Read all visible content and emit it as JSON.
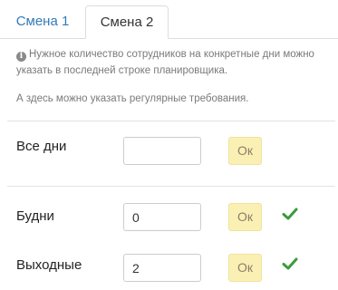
{
  "tabs": [
    {
      "label": "Смена 1",
      "active": false
    },
    {
      "label": "Смена 2",
      "active": true
    }
  ],
  "hints": {
    "info": "Нужное количество сотрудников на конкретные дни можно указать в последней строке планировщика.",
    "regular": "А здесь можно указать регулярные требования."
  },
  "rows": [
    {
      "label": "Все дни",
      "value": "",
      "ok_label": "Ок",
      "confirmed": false
    },
    {
      "label": "Будни",
      "value": "0",
      "ok_label": "Ок",
      "confirmed": true
    },
    {
      "label": "Выходные",
      "value": "2",
      "ok_label": "Ок",
      "confirmed": true
    }
  ],
  "colors": {
    "link": "#337ab7",
    "ok_button_bg": "#fbf0b4",
    "check": "#3c9a3c"
  },
  "icons": {
    "info": "info-circle-icon",
    "confirmed": "check-icon"
  }
}
